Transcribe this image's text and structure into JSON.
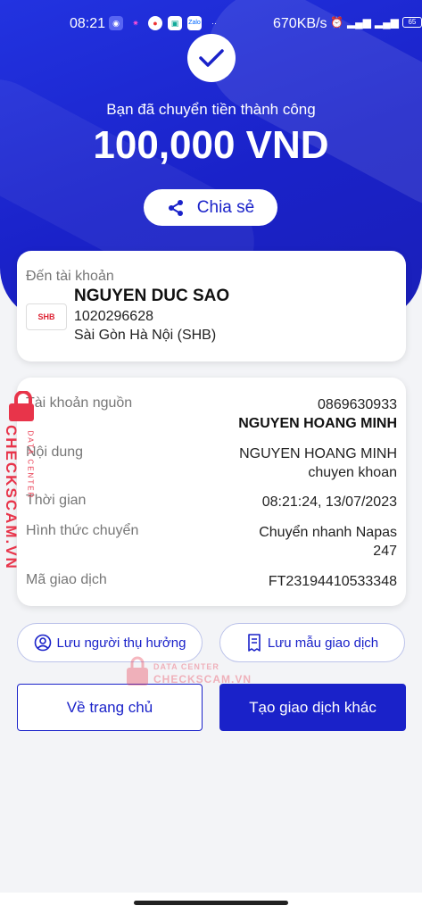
{
  "status_bar": {
    "time": "08:21",
    "net_speed": "670KB/s",
    "battery": "65"
  },
  "result": {
    "message": "Bạn đã chuyển tiền thành công",
    "amount": "100,000 VND",
    "share_label": "Chia sẻ"
  },
  "recipient": {
    "label": "Đến tài khoản",
    "bank_logo": "SHB",
    "name": "NGUYEN DUC SAO",
    "account": "1020296628",
    "bank": "Sài Gòn Hà Nội (SHB)"
  },
  "details": {
    "source_label": "Tài khoản nguồn",
    "source_account": "0869630933",
    "source_name": "NGUYEN HOANG MINH",
    "content_label": "Nội dung",
    "content_line1": "NGUYEN HOANG MINH",
    "content_line2": "chuyen khoan",
    "time_label": "Thời gian",
    "time_value": "08:21:24, 13/07/2023",
    "method_label": "Hình thức chuyển",
    "method_line1": "Chuyển nhanh Napas",
    "method_line2": "247",
    "txn_label": "Mã giao dịch",
    "txn_value": "FT23194410533348"
  },
  "actions": {
    "save_beneficiary": "Lưu người thụ hưởng",
    "save_template": "Lưu mẫu giao dịch",
    "home": "Về trang chủ",
    "new_transaction": "Tạo giao dịch khác"
  },
  "watermark": {
    "brand": "CHECKSCAM.VN",
    "tag": "DATA CENTER"
  },
  "colors": {
    "primary": "#1a22c9",
    "watermark": "#e8344a"
  }
}
